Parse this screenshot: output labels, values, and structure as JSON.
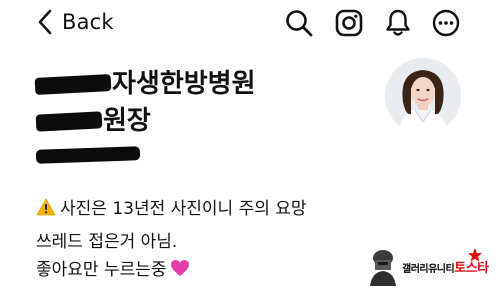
{
  "header": {
    "back_label": "Back"
  },
  "profile": {
    "name_line1_visible": "자생한방병원",
    "name_line2_visible": "원장"
  },
  "post": {
    "line1": "사진은 13년전 사진이니 주의 요망",
    "line2": "쓰레드 접은거 아님.",
    "line3": "좋아요만 누르는중"
  },
  "watermark": {
    "text": "갤러리유니티",
    "brand": "토스타"
  },
  "icons": [
    "chevron-left-icon",
    "search-icon",
    "instagram-icon",
    "bell-icon",
    "more-icon",
    "warning-icon",
    "heart-icon"
  ],
  "colors": {
    "text": "#111111",
    "heart": "#e23fa9",
    "warning": "#f5b400",
    "redaction": "#0b0b0b"
  }
}
